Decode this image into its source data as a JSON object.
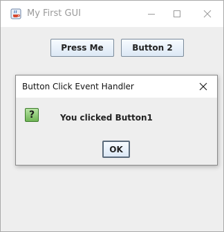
{
  "window": {
    "title": "My First GUI",
    "controls": {
      "minimize": "—",
      "maximize": "☐",
      "close": "✕"
    }
  },
  "toolbar": {
    "press_label": "Press Me",
    "button2_label": "Button 2"
  },
  "dialog": {
    "title": "Button Click Event Handler",
    "icon_glyph": "?",
    "message": "You clicked Button1",
    "ok_label": "OK",
    "close_glyph": "✕"
  },
  "colors": {
    "window_bg": "#eeeeee",
    "titlebar_bg": "#ffffff",
    "question_icon_green": "#6fb455"
  },
  "icons": {
    "app_icon": "java-cup-icon",
    "dialog_icon": "question-icon"
  }
}
